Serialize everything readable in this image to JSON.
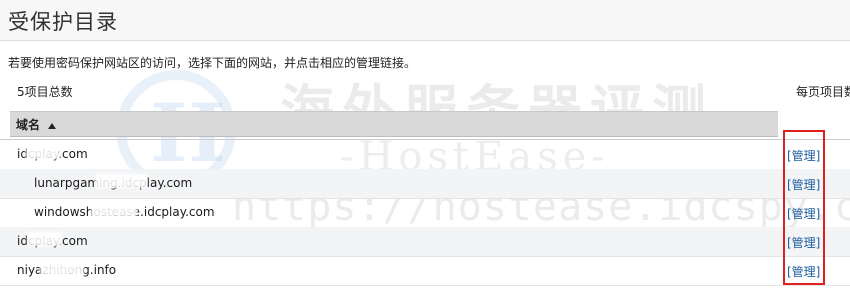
{
  "page": {
    "title": "受保护目录",
    "instructions": "若要使用密码保护网站区的访问，选择下面的网站，并点击相应的管理链接。",
    "count_label": "5项目总数",
    "per_page_label": "每页项目数"
  },
  "table": {
    "header": {
      "domain_label": "域名",
      "sort_icon": "sort-up-icon"
    },
    "rows": [
      {
        "domain": "idcplay.com",
        "manage_label": "[管理]"
      },
      {
        "domain": "lunarpgaming.idcplay.com",
        "manage_label": "[管理]"
      },
      {
        "domain": "windowshostease.idcplay.com",
        "manage_label": "[管理]"
      },
      {
        "domain": "idcplay.com",
        "manage_label": "[管理]"
      },
      {
        "domain": "niyazhihong.info",
        "manage_label": "[管理]"
      }
    ]
  },
  "watermark": {
    "cn": "海外服务器评测",
    "brand": "-HostEase-",
    "url": "https://hostease.idcspy.com/",
    "logo_letter": "H"
  },
  "colors": {
    "link": "#1d5e9f",
    "highlight": "#e02020",
    "header_bg": "#d9d9d9",
    "alt_row_bg": "#f2f4f6"
  }
}
